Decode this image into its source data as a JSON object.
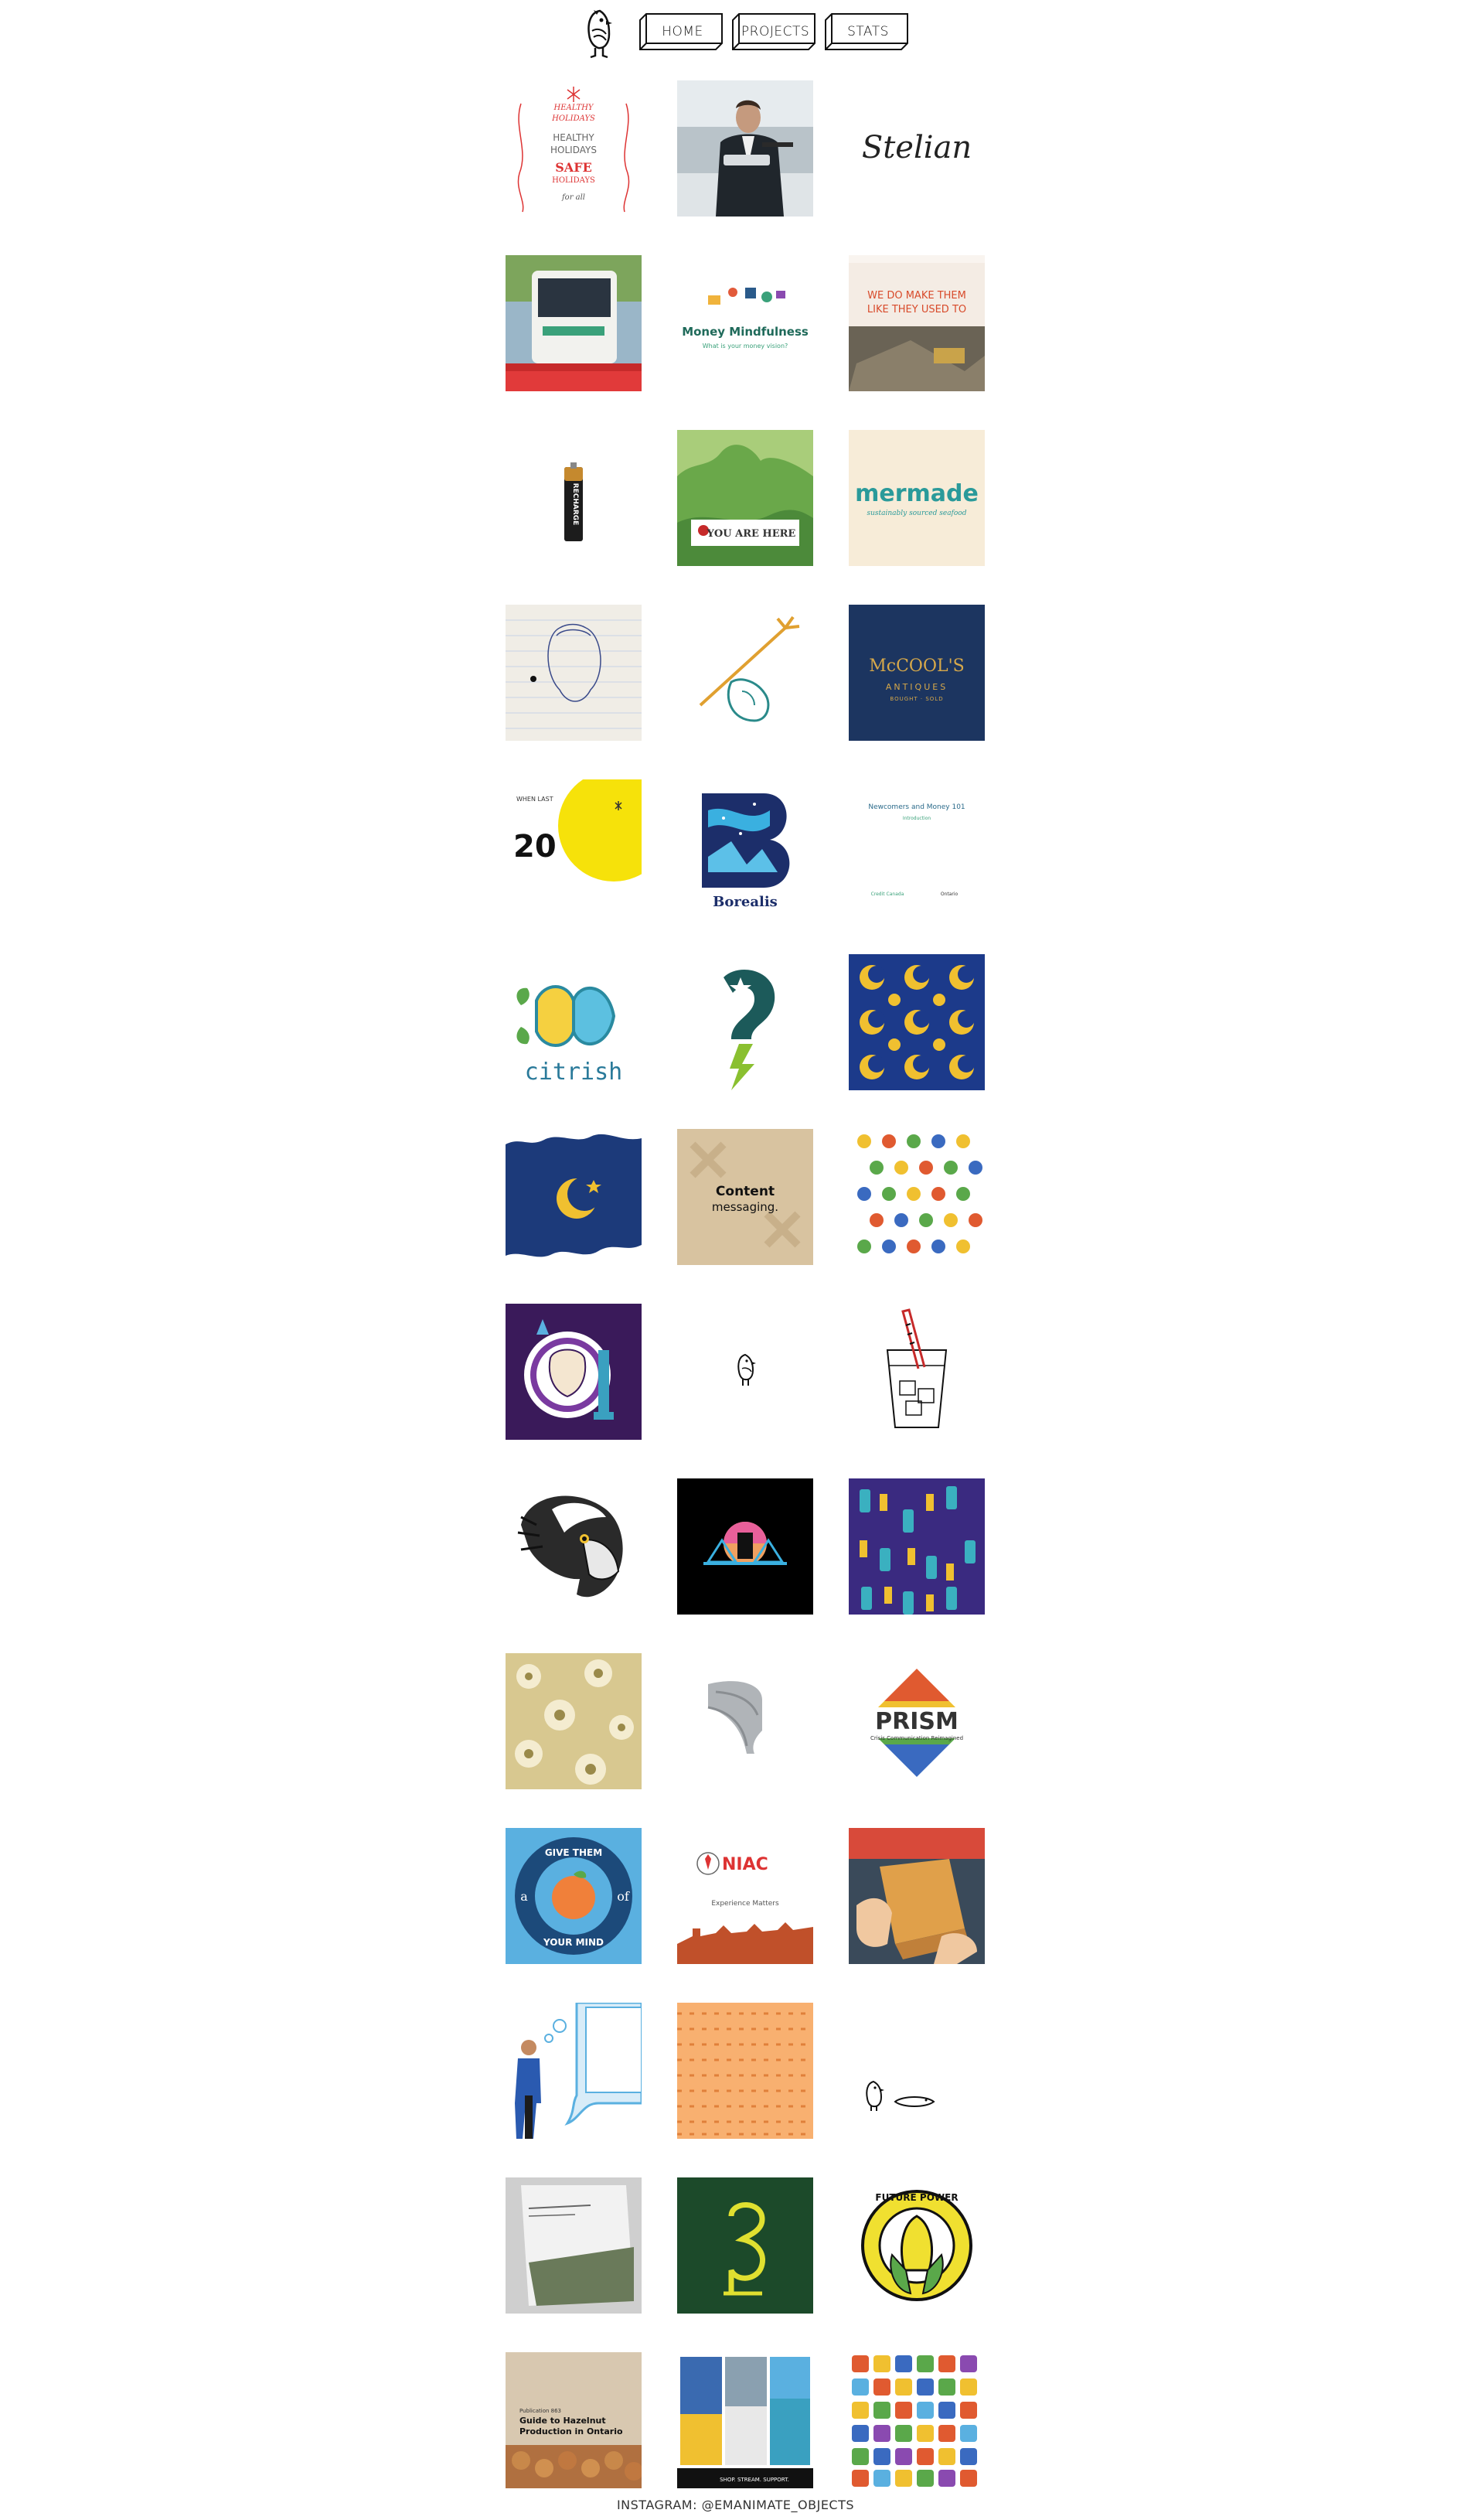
{
  "nav": {
    "home": "HOME",
    "projects": "PROJECTS",
    "stats": "STATS"
  },
  "tiles": {
    "t1": {
      "name": "healthy-holidays",
      "l1": "HEALTHY",
      "l2": "HOLIDAYS",
      "l3": "SAFE",
      "l4": "HOLIDAYS",
      "l5": "for all"
    },
    "t2": {
      "name": "man-photo"
    },
    "t3": {
      "name": "signature",
      "text": "Stelian"
    },
    "t4": {
      "name": "bus-photo"
    },
    "t5": {
      "name": "money-mindfulness",
      "title": "Money Mindfulness",
      "sub": "What is your money vision?"
    },
    "t6": {
      "name": "vintage-ad",
      "l1": "WE DO MAKE THEM",
      "l2": "LIKE THEY USED TO"
    },
    "t7": {
      "name": "battery",
      "text": "RECHARGE"
    },
    "t8": {
      "name": "you-are-here",
      "text": "YOU ARE HERE"
    },
    "t9": {
      "name": "mermade",
      "title": "mermade",
      "sub": "sustainably sourced seafood"
    },
    "t10": {
      "name": "statue-sketch"
    },
    "t11": {
      "name": "trident-hand"
    },
    "t12": {
      "name": "mccools",
      "l1": "McCOOL'S",
      "l2": "ANTIQUES",
      "l3": "BOUGHT · SOLD"
    },
    "t13": {
      "name": "lemon-2020",
      "head": "WHEN LAST",
      "num": "20"
    },
    "t14": {
      "name": "borealis",
      "text": "Borealis"
    },
    "t15": {
      "name": "newcomers",
      "title": "Newcomers and Money 101",
      "sub": "Introduction",
      "footer1": "Credit Canada",
      "footer2": "Ontario"
    },
    "t16": {
      "name": "citrish",
      "text": "citrish"
    },
    "t17": {
      "name": "star-bolt"
    },
    "t18": {
      "name": "moon-pattern"
    },
    "t19": {
      "name": "moon-cloud"
    },
    "t20": {
      "name": "content-messaging",
      "l1": "Content",
      "l2": "messaging."
    },
    "t21": {
      "name": "fruit-pattern"
    },
    "t22": {
      "name": "liberty-chess"
    },
    "t23": {
      "name": "bird-small"
    },
    "t24": {
      "name": "drink-glass"
    },
    "t25": {
      "name": "eagle-head"
    },
    "t26": {
      "name": "castle-night"
    },
    "t27": {
      "name": "chess-pattern"
    },
    "t28": {
      "name": "floral-pattern"
    },
    "t29": {
      "name": "wing"
    },
    "t30": {
      "name": "prism",
      "title": "PRISM",
      "sub": "Crisis Communication Reimagined"
    },
    "t31": {
      "name": "give-peach",
      "top": "GIVE THEM",
      "bottom": "YOUR MIND",
      "a": "a",
      "of": "of"
    },
    "t32": {
      "name": "niac",
      "title": "NIAC",
      "sub": "Experience Matters"
    },
    "t33": {
      "name": "package-hands"
    },
    "t34": {
      "name": "thinking-man"
    },
    "t35": {
      "name": "orange-pattern"
    },
    "t36": {
      "name": "bird-lying"
    },
    "t37": {
      "name": "brochure"
    },
    "t38": {
      "name": "green-logo"
    },
    "t39": {
      "name": "future-power",
      "text": "FUTURE POWER"
    },
    "t40": {
      "name": "hazelnut",
      "l0": "Publication 863",
      "l1": "Guide to Hazelnut",
      "l2": "Production in Ontario"
    },
    "t41": {
      "name": "posters",
      "foot": "SHOP. STREAM. SUPPORT."
    },
    "t42": {
      "name": "letters-pattern"
    }
  },
  "footer": "INSTAGRAM: @EMANIMATE_OBJECTS"
}
